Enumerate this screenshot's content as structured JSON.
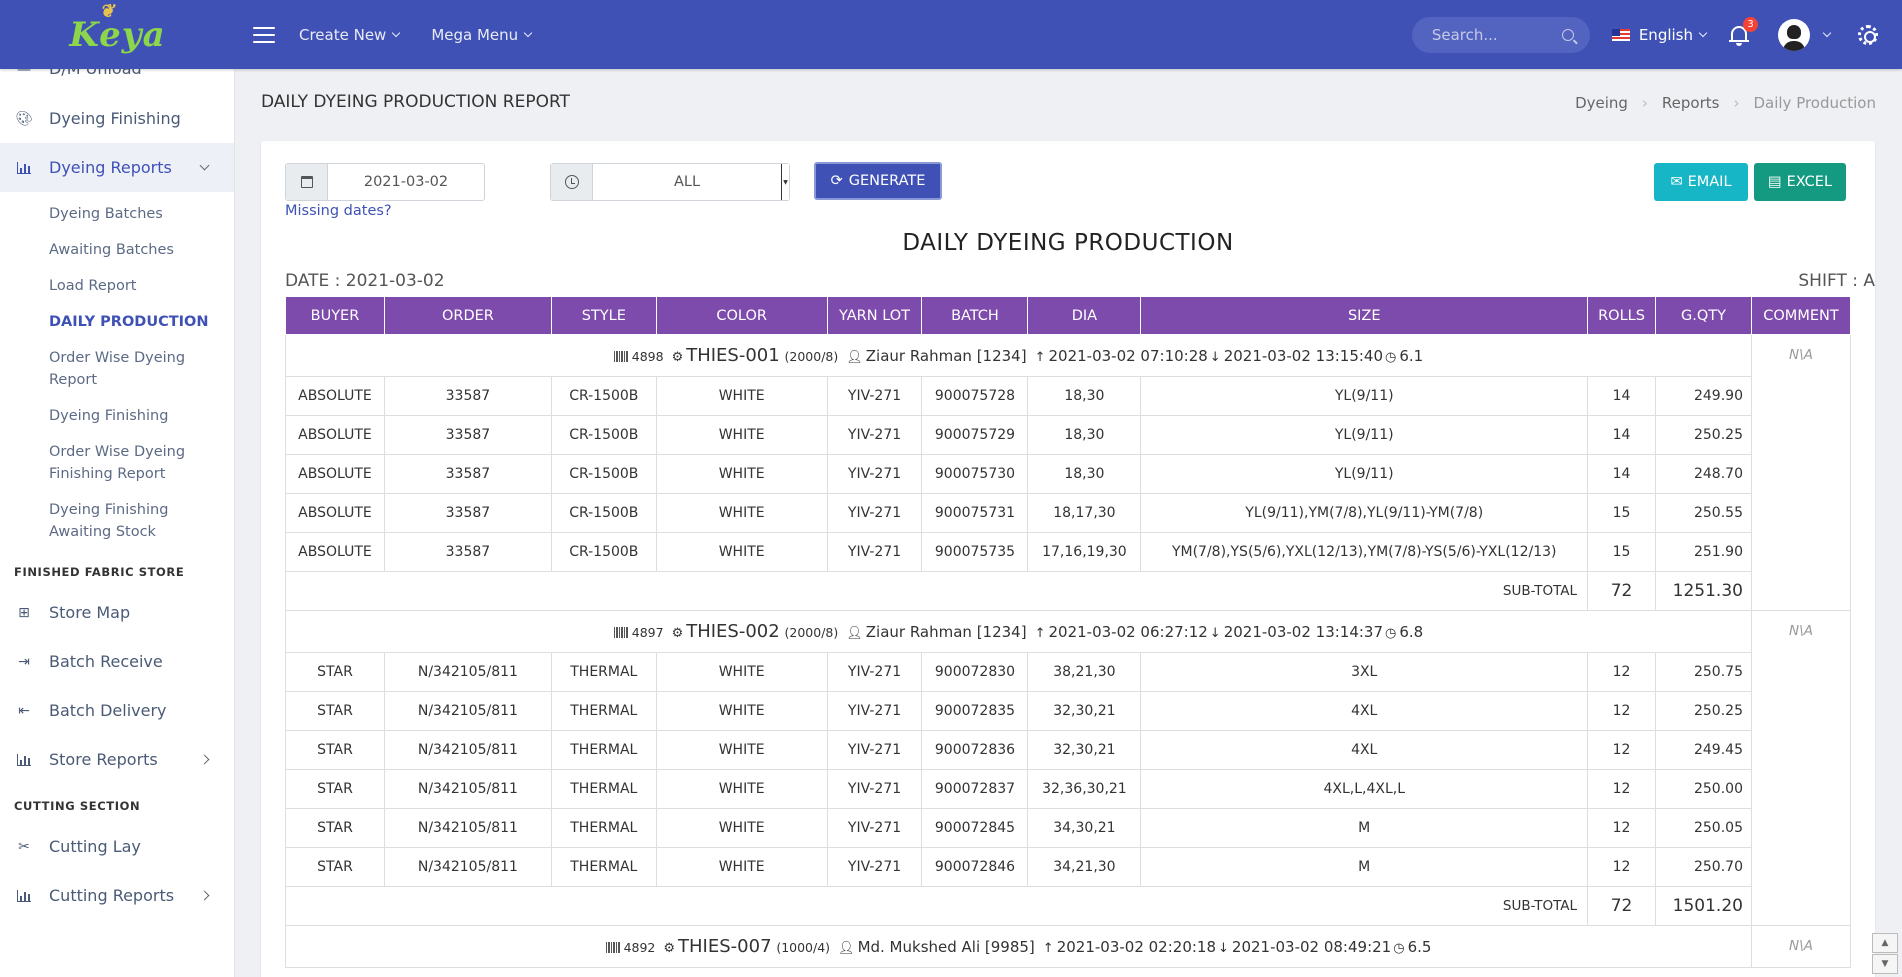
{
  "app": {
    "logo_text": "Keya",
    "nav": {
      "create_new": "Create New",
      "mega_menu": "Mega Menu"
    },
    "search_placeholder": "Search...",
    "language": "English",
    "notif_count": "3"
  },
  "sidebar": {
    "partial_top": "D/M Unload",
    "items": {
      "dyeing_finishing": "Dyeing Finishing",
      "dyeing_reports": "Dyeing Reports",
      "store_map": "Store Map",
      "batch_receive": "Batch Receive",
      "batch_delivery": "Batch Delivery",
      "store_reports": "Store Reports",
      "cutting_lay": "Cutting Lay",
      "cutting_reports": "Cutting Reports"
    },
    "sub": [
      "Dyeing Batches",
      "Awaiting Batches",
      "Load Report",
      "DAILY PRODUCTION",
      "Order Wise Dyeing Report",
      "Dyeing Finishing",
      "Order Wise Dyeing Finishing Report",
      "Dyeing Finishing Awaiting Stock"
    ],
    "headings": {
      "finished": "FINISHED FABRIC STORE",
      "cutting": "CUTTING SECTION"
    }
  },
  "page": {
    "title": "DAILY DYEING PRODUCTION REPORT",
    "breadcrumb": [
      "Dyeing",
      "Reports",
      "Daily Production"
    ]
  },
  "controls": {
    "date": "2021-03-02",
    "shift": "ALL",
    "generate": "GENERATE",
    "missing": "Missing dates?",
    "email": "EMAIL",
    "excel": "EXCEL"
  },
  "report": {
    "title": "DAILY DYEING PRODUCTION",
    "date_line": "DATE : 2021-03-02",
    "shift_line": "SHIFT : A",
    "columns": [
      "BUYER",
      "ORDER",
      "STYLE",
      "COLOR",
      "YARN LOT",
      "BATCH",
      "DIA",
      "SIZE",
      "ROLLS",
      "G.QTY",
      "COMMENT"
    ],
    "subtotal_label": "SUB-TOTAL",
    "groups": [
      {
        "barcode": "4898",
        "machine": "THIES-001",
        "capacity": "(2000/8)",
        "operator": "Ziaur Rahman [1234]",
        "start": "2021-03-02 07:10:28",
        "end": "2021-03-02 13:15:40",
        "duration": "6.1",
        "comment": "N\\A",
        "rows": [
          [
            "ABSOLUTE",
            "33587",
            "CR-1500B",
            "WHITE",
            "YIV-271",
            "900075728",
            "18,30",
            "YL(9/11)",
            "14",
            "249.90"
          ],
          [
            "ABSOLUTE",
            "33587",
            "CR-1500B",
            "WHITE",
            "YIV-271",
            "900075729",
            "18,30",
            "YL(9/11)",
            "14",
            "250.25"
          ],
          [
            "ABSOLUTE",
            "33587",
            "CR-1500B",
            "WHITE",
            "YIV-271",
            "900075730",
            "18,30",
            "YL(9/11)",
            "14",
            "248.70"
          ],
          [
            "ABSOLUTE",
            "33587",
            "CR-1500B",
            "WHITE",
            "YIV-271",
            "900075731",
            "18,17,30",
            "YL(9/11),YM(7/8),YL(9/11)-YM(7/8)",
            "15",
            "250.55"
          ],
          [
            "ABSOLUTE",
            "33587",
            "CR-1500B",
            "WHITE",
            "YIV-271",
            "900075735",
            "17,16,19,30",
            "YM(7/8),YS(5/6),YXL(12/13),YM(7/8)-YS(5/6)-YXL(12/13)",
            "15",
            "251.90"
          ]
        ],
        "subtotal_rolls": "72",
        "subtotal_qty": "1251.30"
      },
      {
        "barcode": "4897",
        "machine": "THIES-002",
        "capacity": "(2000/8)",
        "operator": "Ziaur Rahman [1234]",
        "start": "2021-03-02 06:27:12",
        "end": "2021-03-02 13:14:37",
        "duration": "6.8",
        "comment": "N\\A",
        "rows": [
          [
            "STAR",
            "N/342105/811",
            "THERMAL",
            "WHITE",
            "YIV-271",
            "900072830",
            "38,21,30",
            "3XL",
            "12",
            "250.75"
          ],
          [
            "STAR",
            "N/342105/811",
            "THERMAL",
            "WHITE",
            "YIV-271",
            "900072835",
            "32,30,21",
            "4XL",
            "12",
            "250.25"
          ],
          [
            "STAR",
            "N/342105/811",
            "THERMAL",
            "WHITE",
            "YIV-271",
            "900072836",
            "32,30,21",
            "4XL",
            "12",
            "249.45"
          ],
          [
            "STAR",
            "N/342105/811",
            "THERMAL",
            "WHITE",
            "YIV-271",
            "900072837",
            "32,36,30,21",
            "4XL,L,4XL,L",
            "12",
            "250.00"
          ],
          [
            "STAR",
            "N/342105/811",
            "THERMAL",
            "WHITE",
            "YIV-271",
            "900072845",
            "34,30,21",
            "M",
            "12",
            "250.05"
          ],
          [
            "STAR",
            "N/342105/811",
            "THERMAL",
            "WHITE",
            "YIV-271",
            "900072846",
            "34,21,30",
            "M",
            "12",
            "250.70"
          ]
        ],
        "subtotal_rolls": "72",
        "subtotal_qty": "1501.20"
      },
      {
        "barcode": "4892",
        "machine": "THIES-007",
        "capacity": "(1000/4)",
        "operator": "Md. Mukshed Ali [9985]",
        "start": "2021-03-02 02:20:18",
        "end": "2021-03-02 08:49:21",
        "duration": "6.5",
        "comment": "N\\A",
        "rows": [],
        "subtotal_rolls": null,
        "subtotal_qty": null
      }
    ]
  }
}
